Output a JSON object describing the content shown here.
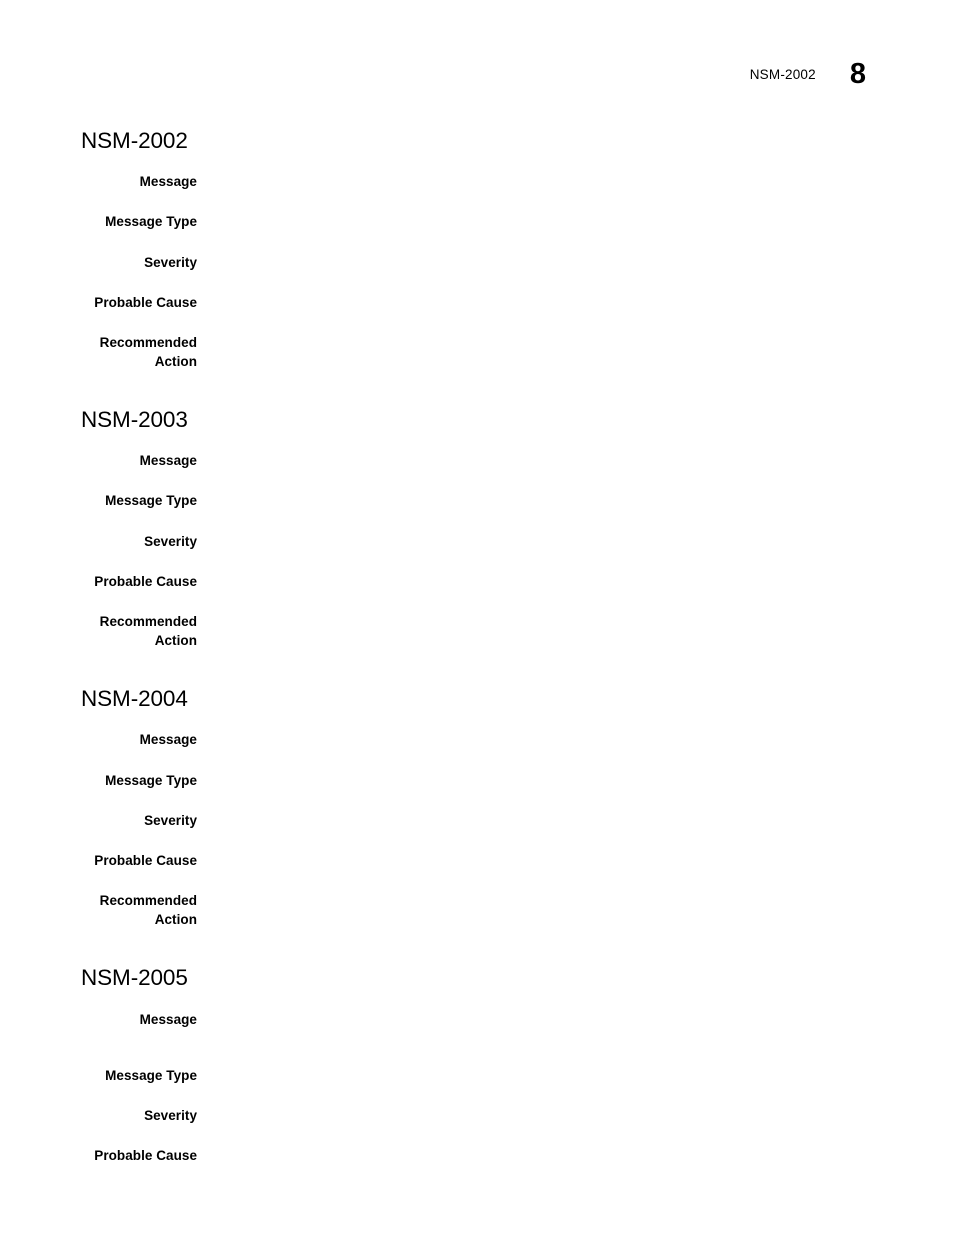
{
  "header": {
    "topic": "NSM-2002",
    "page_number": "8"
  },
  "labels": {
    "message": "Message",
    "message_type": "Message Type",
    "severity": "Severity",
    "probable_cause": "Probable Cause",
    "recommended_action": "Recommended\nAction"
  },
  "sections": [
    {
      "heading": "NSM-2002",
      "fields": [
        {
          "label": "Message",
          "value": ""
        },
        {
          "label": "Message Type",
          "value": ""
        },
        {
          "label": "Severity",
          "value": ""
        },
        {
          "label": "Probable Cause",
          "value": ""
        },
        {
          "label": "Recommended\nAction",
          "value": ""
        }
      ]
    },
    {
      "heading": "NSM-2003",
      "fields": [
        {
          "label": "Message",
          "value": ""
        },
        {
          "label": "Message Type",
          "value": ""
        },
        {
          "label": "Severity",
          "value": ""
        },
        {
          "label": "Probable Cause",
          "value": ""
        },
        {
          "label": "Recommended\nAction",
          "value": ""
        }
      ]
    },
    {
      "heading": "NSM-2004",
      "fields": [
        {
          "label": "Message",
          "value": ""
        },
        {
          "label": "Message Type",
          "value": ""
        },
        {
          "label": "Severity",
          "value": ""
        },
        {
          "label": "Probable Cause",
          "value": ""
        },
        {
          "label": "Recommended\nAction",
          "value": ""
        }
      ]
    },
    {
      "heading": "NSM-2005",
      "fields": [
        {
          "label": "Message",
          "value": ""
        },
        {
          "label": "Message Type",
          "value": ""
        },
        {
          "label": "Severity",
          "value": ""
        },
        {
          "label": "Probable Cause",
          "value": ""
        }
      ]
    }
  ]
}
